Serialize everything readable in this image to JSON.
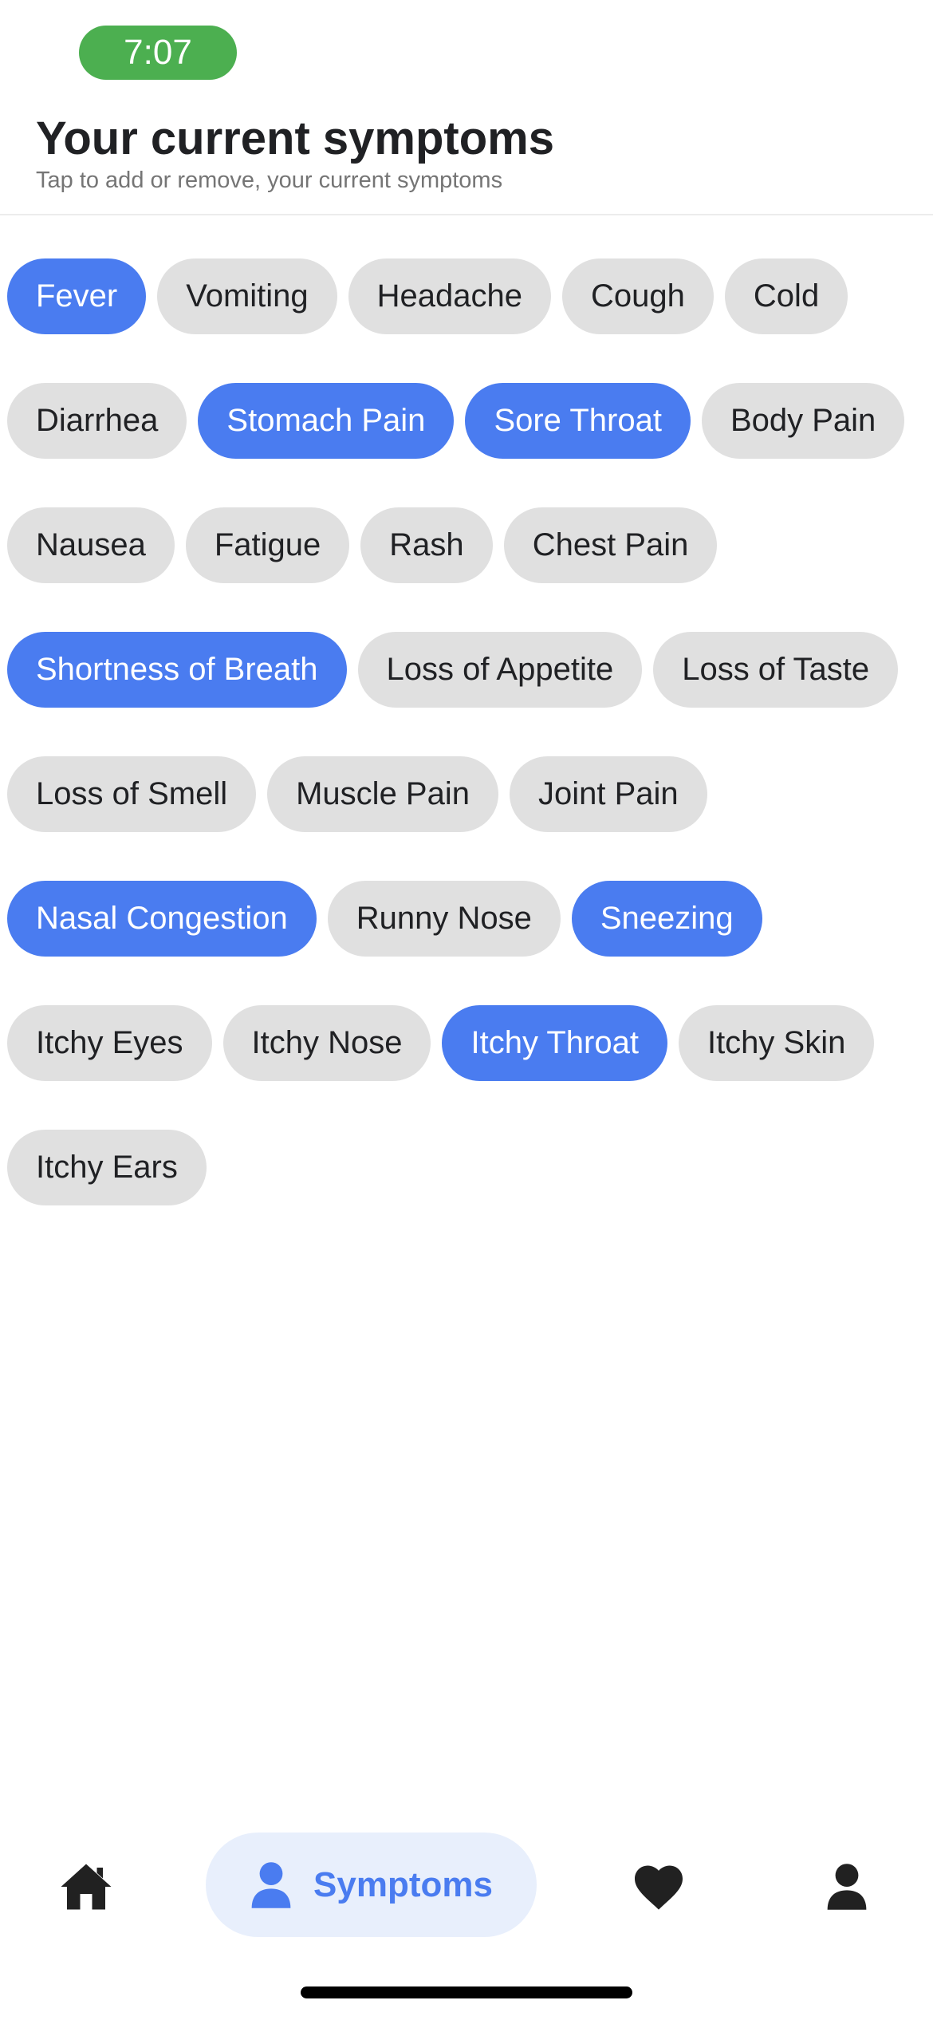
{
  "status_bar": {
    "time": "7:07"
  },
  "header": {
    "title": "Your current symptoms",
    "subtitle": "Tap to add or remove, your current symptoms"
  },
  "symptoms": [
    {
      "label": "Fever",
      "selected": true
    },
    {
      "label": "Vomiting",
      "selected": false
    },
    {
      "label": "Headache",
      "selected": false
    },
    {
      "label": "Cough",
      "selected": false
    },
    {
      "label": "Cold",
      "selected": false
    },
    {
      "label": "Diarrhea",
      "selected": false
    },
    {
      "label": "Stomach Pain",
      "selected": true
    },
    {
      "label": "Sore Throat",
      "selected": true
    },
    {
      "label": "Body Pain",
      "selected": false
    },
    {
      "label": "Nausea",
      "selected": false
    },
    {
      "label": "Fatigue",
      "selected": false
    },
    {
      "label": "Rash",
      "selected": false
    },
    {
      "label": "Chest Pain",
      "selected": false
    },
    {
      "label": "Shortness of Breath",
      "selected": true
    },
    {
      "label": "Loss of Appetite",
      "selected": false
    },
    {
      "label": "Loss of Taste",
      "selected": false
    },
    {
      "label": "Loss of Smell",
      "selected": false
    },
    {
      "label": "Muscle Pain",
      "selected": false
    },
    {
      "label": "Joint Pain",
      "selected": false
    },
    {
      "label": "Nasal Congestion",
      "selected": true
    },
    {
      "label": "Runny Nose",
      "selected": false
    },
    {
      "label": "Sneezing",
      "selected": true
    },
    {
      "label": "Itchy Eyes",
      "selected": false
    },
    {
      "label": "Itchy Nose",
      "selected": false
    },
    {
      "label": "Itchy Throat",
      "selected": true
    },
    {
      "label": "Itchy Skin",
      "selected": false
    },
    {
      "label": "Itchy Ears",
      "selected": false
    }
  ],
  "bottom_nav": {
    "items": [
      {
        "icon": "home-icon",
        "label": "",
        "active": false
      },
      {
        "icon": "person-icon",
        "label": "Symptoms",
        "active": true
      },
      {
        "icon": "heart-icon",
        "label": "",
        "active": false
      },
      {
        "icon": "profile-icon",
        "label": "",
        "active": false
      }
    ]
  },
  "colors": {
    "accent": "#4a7cf0",
    "chip_bg": "#e0e0e0",
    "time_pill": "#4caf50",
    "nav_active_bg": "#e8effc"
  }
}
